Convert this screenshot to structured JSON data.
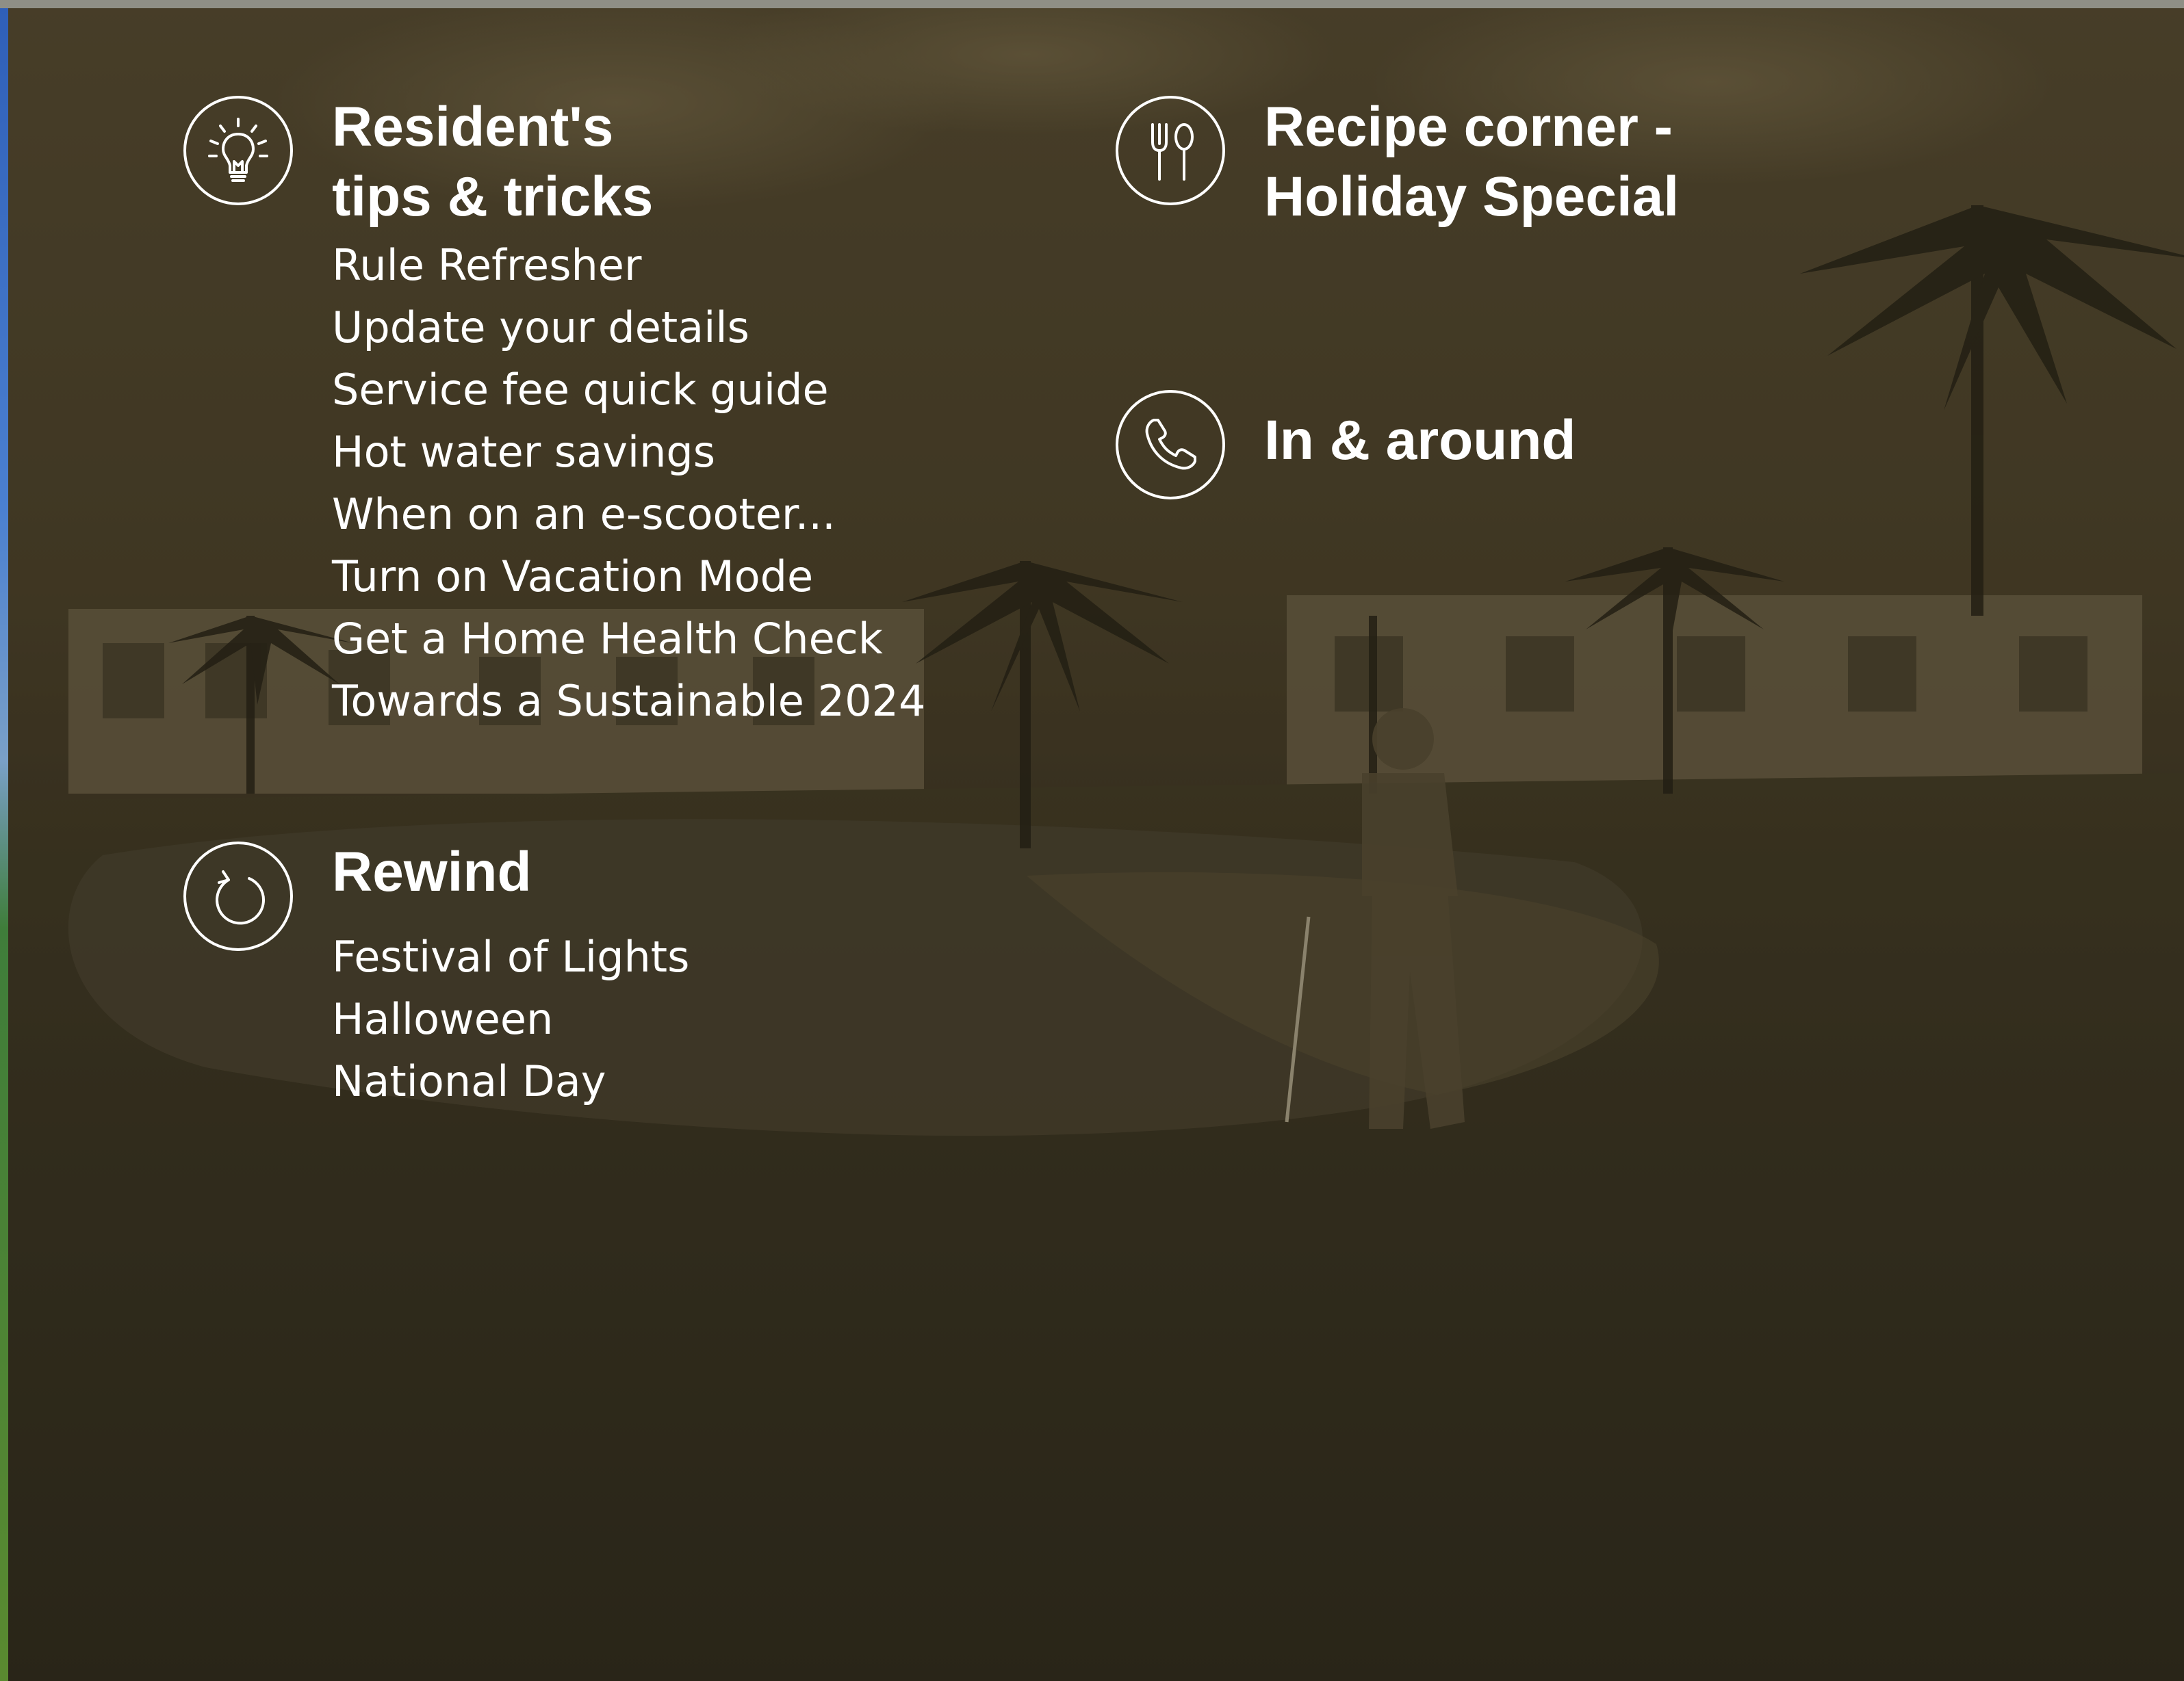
{
  "sections": {
    "tips": {
      "icon": "lightbulb-icon",
      "title_line1": "Resident's",
      "title_line2": "tips & tricks",
      "items": [
        "Rule Refresher",
        "Update your details",
        "Service fee quick guide",
        "Hot water savings",
        "When on an e-scooter...",
        "Turn on Vacation Mode",
        "Get a Home Health Check",
        "Towards a Sustainable 2024"
      ]
    },
    "recipe": {
      "icon": "fork-spoon-icon",
      "title_line1": "Recipe corner -",
      "title_line2": "Holiday Special"
    },
    "around": {
      "icon": "phone-icon",
      "title": "In & around"
    },
    "rewind": {
      "icon": "rewind-icon",
      "title": "Rewind",
      "items": [
        "Festival of Lights",
        "Halloween",
        "National Day"
      ]
    }
  },
  "colors": {
    "overlay": "#3a3322",
    "text": "#ffffff",
    "sky_tint": "#5a5037",
    "grass_tint": "#2c2a1a"
  }
}
